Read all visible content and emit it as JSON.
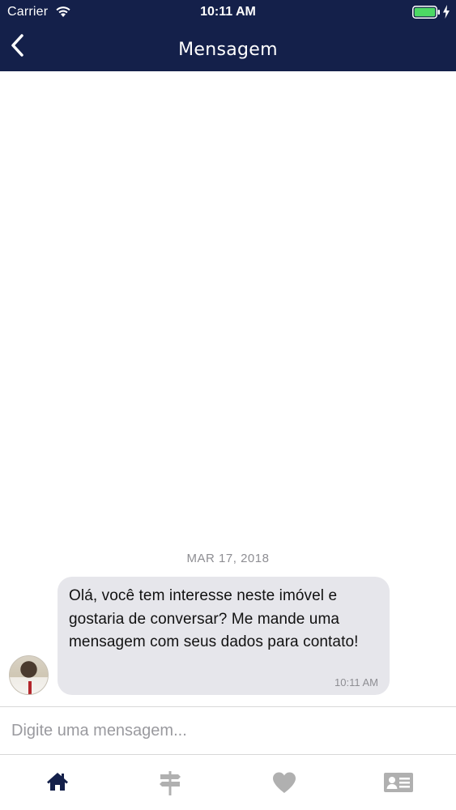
{
  "status_bar": {
    "carrier": "Carrier",
    "time": "10:11 AM",
    "battery_color": "#4cd964"
  },
  "header": {
    "title": "Mensagem",
    "background": "#14204a",
    "back_icon": "chevron-left-icon"
  },
  "chat": {
    "date": "MAR 17, 2018",
    "messages": [
      {
        "text": "Olá, você tem interesse neste imóvel e gostaria de conversar? Me mande uma mensagem com seus dados para contato!",
        "time": "10:11 AM",
        "sender_avatar": "agent-photo"
      }
    ]
  },
  "composer": {
    "placeholder": "Digite uma mensagem...",
    "value": ""
  },
  "tab_bar": {
    "tabs": [
      {
        "icon": "home-icon",
        "active": true
      },
      {
        "icon": "signpost-icon",
        "active": false
      },
      {
        "icon": "heart-icon",
        "active": false
      },
      {
        "icon": "contact-card-icon",
        "active": false
      }
    ],
    "active_color": "#14204a",
    "inactive_color": "#b0b0b0"
  }
}
